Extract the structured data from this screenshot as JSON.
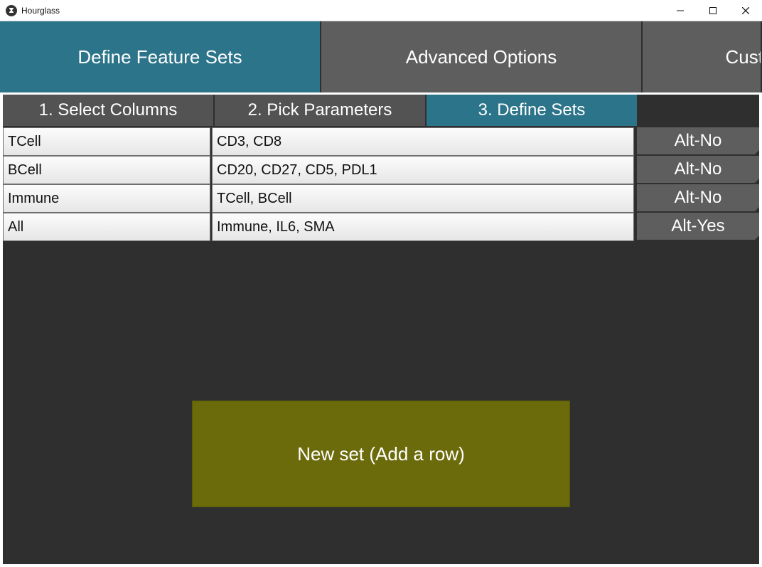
{
  "window": {
    "title": "Hourglass"
  },
  "main_tabs": [
    {
      "label": "Define Feature Sets",
      "active": true
    },
    {
      "label": "Advanced Options",
      "active": false
    },
    {
      "label": "Cust",
      "active": false
    }
  ],
  "sub_tabs": [
    {
      "label": "1. Select Columns",
      "active": false
    },
    {
      "label": "2. Pick Parameters",
      "active": false
    },
    {
      "label": "3. Define Sets",
      "active": true
    }
  ],
  "rows": [
    {
      "name": "TCell",
      "members": "CD3, CD8",
      "alt": "Alt-No"
    },
    {
      "name": "BCell",
      "members": "CD20, CD27, CD5, PDL1",
      "alt": "Alt-No"
    },
    {
      "name": "Immune",
      "members": "TCell, BCell",
      "alt": "Alt-No"
    },
    {
      "name": "All",
      "members": "Immune, IL6, SMA",
      "alt": "Alt-Yes"
    }
  ],
  "new_set_button": "New set (Add a row)"
}
